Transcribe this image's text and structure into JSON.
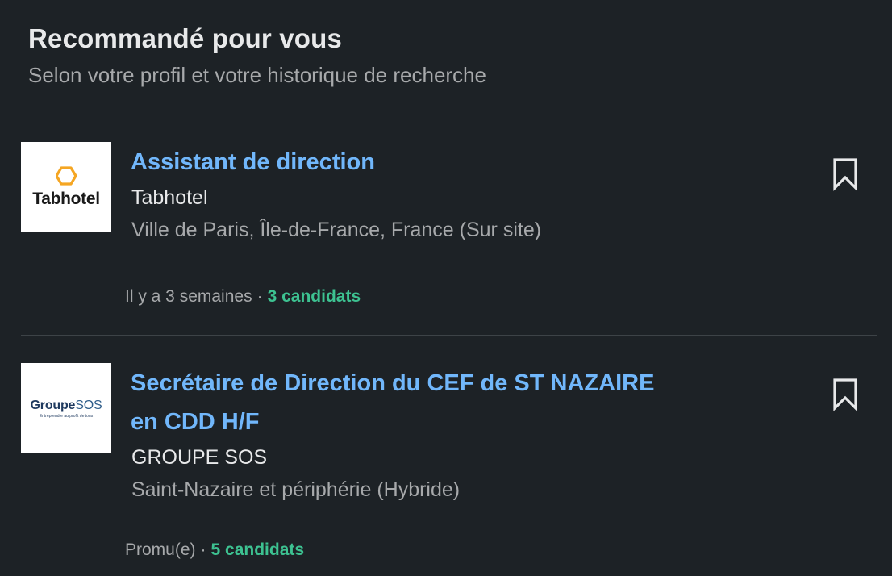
{
  "header": {
    "title": "Recommandé pour vous",
    "subtitle": "Selon votre profil et votre historique de recherche"
  },
  "jobs": [
    {
      "title": "Assistant de direction",
      "company": "Tabhotel",
      "location": "Ville de Paris, Île-de-France, France (Sur site)",
      "posted": "Il y a 3 semaines",
      "separator": "·",
      "applicants": "3 candidats",
      "logo": {
        "text": "Tabhotel",
        "icon": "hexagon-icon",
        "accent": "#f5a623"
      }
    },
    {
      "title_line1": "Secrétaire de Direction du CEF de ST NAZAIRE",
      "title_line2": "en CDD H/F",
      "company": "GROUPE SOS",
      "location": "Saint-Nazaire et périphérie (Hybride)",
      "posted": "Promu(e)",
      "separator": "·",
      "applicants": "5 candidats",
      "logo": {
        "text_main": "Groupe",
        "text_sos": "SOS",
        "tagline": "Entreprendre au profit de tous"
      }
    }
  ],
  "icons": {
    "save": "bookmark-icon"
  },
  "colors": {
    "background": "#1d2226",
    "link": "#71b7fb",
    "applicants": "#3dc291",
    "text_primary": "#e8e9ea",
    "text_secondary": "#a7a9ab"
  }
}
